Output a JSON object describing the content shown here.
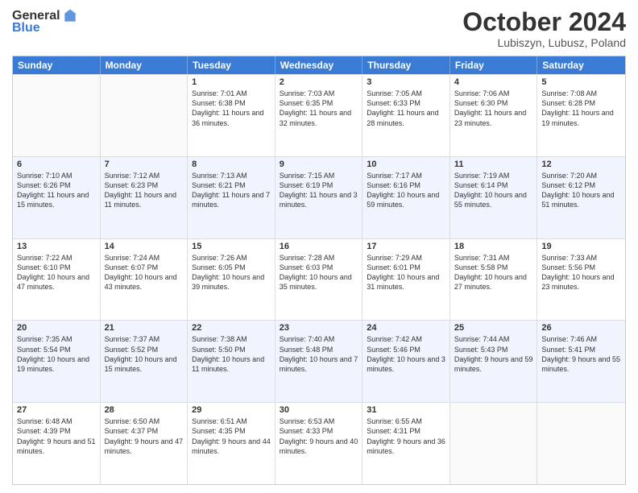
{
  "header": {
    "logo_general": "General",
    "logo_blue": "Blue",
    "month_title": "October 2024",
    "location": "Lubiszyn, Lubusz, Poland"
  },
  "days_of_week": [
    "Sunday",
    "Monday",
    "Tuesday",
    "Wednesday",
    "Thursday",
    "Friday",
    "Saturday"
  ],
  "weeks": [
    [
      {
        "day": "",
        "info": ""
      },
      {
        "day": "",
        "info": ""
      },
      {
        "day": "1",
        "info": "Sunrise: 7:01 AM\nSunset: 6:38 PM\nDaylight: 11 hours and 36 minutes."
      },
      {
        "day": "2",
        "info": "Sunrise: 7:03 AM\nSunset: 6:35 PM\nDaylight: 11 hours and 32 minutes."
      },
      {
        "day": "3",
        "info": "Sunrise: 7:05 AM\nSunset: 6:33 PM\nDaylight: 11 hours and 28 minutes."
      },
      {
        "day": "4",
        "info": "Sunrise: 7:06 AM\nSunset: 6:30 PM\nDaylight: 11 hours and 23 minutes."
      },
      {
        "day": "5",
        "info": "Sunrise: 7:08 AM\nSunset: 6:28 PM\nDaylight: 11 hours and 19 minutes."
      }
    ],
    [
      {
        "day": "6",
        "info": "Sunrise: 7:10 AM\nSunset: 6:26 PM\nDaylight: 11 hours and 15 minutes."
      },
      {
        "day": "7",
        "info": "Sunrise: 7:12 AM\nSunset: 6:23 PM\nDaylight: 11 hours and 11 minutes."
      },
      {
        "day": "8",
        "info": "Sunrise: 7:13 AM\nSunset: 6:21 PM\nDaylight: 11 hours and 7 minutes."
      },
      {
        "day": "9",
        "info": "Sunrise: 7:15 AM\nSunset: 6:19 PM\nDaylight: 11 hours and 3 minutes."
      },
      {
        "day": "10",
        "info": "Sunrise: 7:17 AM\nSunset: 6:16 PM\nDaylight: 10 hours and 59 minutes."
      },
      {
        "day": "11",
        "info": "Sunrise: 7:19 AM\nSunset: 6:14 PM\nDaylight: 10 hours and 55 minutes."
      },
      {
        "day": "12",
        "info": "Sunrise: 7:20 AM\nSunset: 6:12 PM\nDaylight: 10 hours and 51 minutes."
      }
    ],
    [
      {
        "day": "13",
        "info": "Sunrise: 7:22 AM\nSunset: 6:10 PM\nDaylight: 10 hours and 47 minutes."
      },
      {
        "day": "14",
        "info": "Sunrise: 7:24 AM\nSunset: 6:07 PM\nDaylight: 10 hours and 43 minutes."
      },
      {
        "day": "15",
        "info": "Sunrise: 7:26 AM\nSunset: 6:05 PM\nDaylight: 10 hours and 39 minutes."
      },
      {
        "day": "16",
        "info": "Sunrise: 7:28 AM\nSunset: 6:03 PM\nDaylight: 10 hours and 35 minutes."
      },
      {
        "day": "17",
        "info": "Sunrise: 7:29 AM\nSunset: 6:01 PM\nDaylight: 10 hours and 31 minutes."
      },
      {
        "day": "18",
        "info": "Sunrise: 7:31 AM\nSunset: 5:58 PM\nDaylight: 10 hours and 27 minutes."
      },
      {
        "day": "19",
        "info": "Sunrise: 7:33 AM\nSunset: 5:56 PM\nDaylight: 10 hours and 23 minutes."
      }
    ],
    [
      {
        "day": "20",
        "info": "Sunrise: 7:35 AM\nSunset: 5:54 PM\nDaylight: 10 hours and 19 minutes."
      },
      {
        "day": "21",
        "info": "Sunrise: 7:37 AM\nSunset: 5:52 PM\nDaylight: 10 hours and 15 minutes."
      },
      {
        "day": "22",
        "info": "Sunrise: 7:38 AM\nSunset: 5:50 PM\nDaylight: 10 hours and 11 minutes."
      },
      {
        "day": "23",
        "info": "Sunrise: 7:40 AM\nSunset: 5:48 PM\nDaylight: 10 hours and 7 minutes."
      },
      {
        "day": "24",
        "info": "Sunrise: 7:42 AM\nSunset: 5:46 PM\nDaylight: 10 hours and 3 minutes."
      },
      {
        "day": "25",
        "info": "Sunrise: 7:44 AM\nSunset: 5:43 PM\nDaylight: 9 hours and 59 minutes."
      },
      {
        "day": "26",
        "info": "Sunrise: 7:46 AM\nSunset: 5:41 PM\nDaylight: 9 hours and 55 minutes."
      }
    ],
    [
      {
        "day": "27",
        "info": "Sunrise: 6:48 AM\nSunset: 4:39 PM\nDaylight: 9 hours and 51 minutes."
      },
      {
        "day": "28",
        "info": "Sunrise: 6:50 AM\nSunset: 4:37 PM\nDaylight: 9 hours and 47 minutes."
      },
      {
        "day": "29",
        "info": "Sunrise: 6:51 AM\nSunset: 4:35 PM\nDaylight: 9 hours and 44 minutes."
      },
      {
        "day": "30",
        "info": "Sunrise: 6:53 AM\nSunset: 4:33 PM\nDaylight: 9 hours and 40 minutes."
      },
      {
        "day": "31",
        "info": "Sunrise: 6:55 AM\nSunset: 4:31 PM\nDaylight: 9 hours and 36 minutes."
      },
      {
        "day": "",
        "info": ""
      },
      {
        "day": "",
        "info": ""
      }
    ]
  ]
}
